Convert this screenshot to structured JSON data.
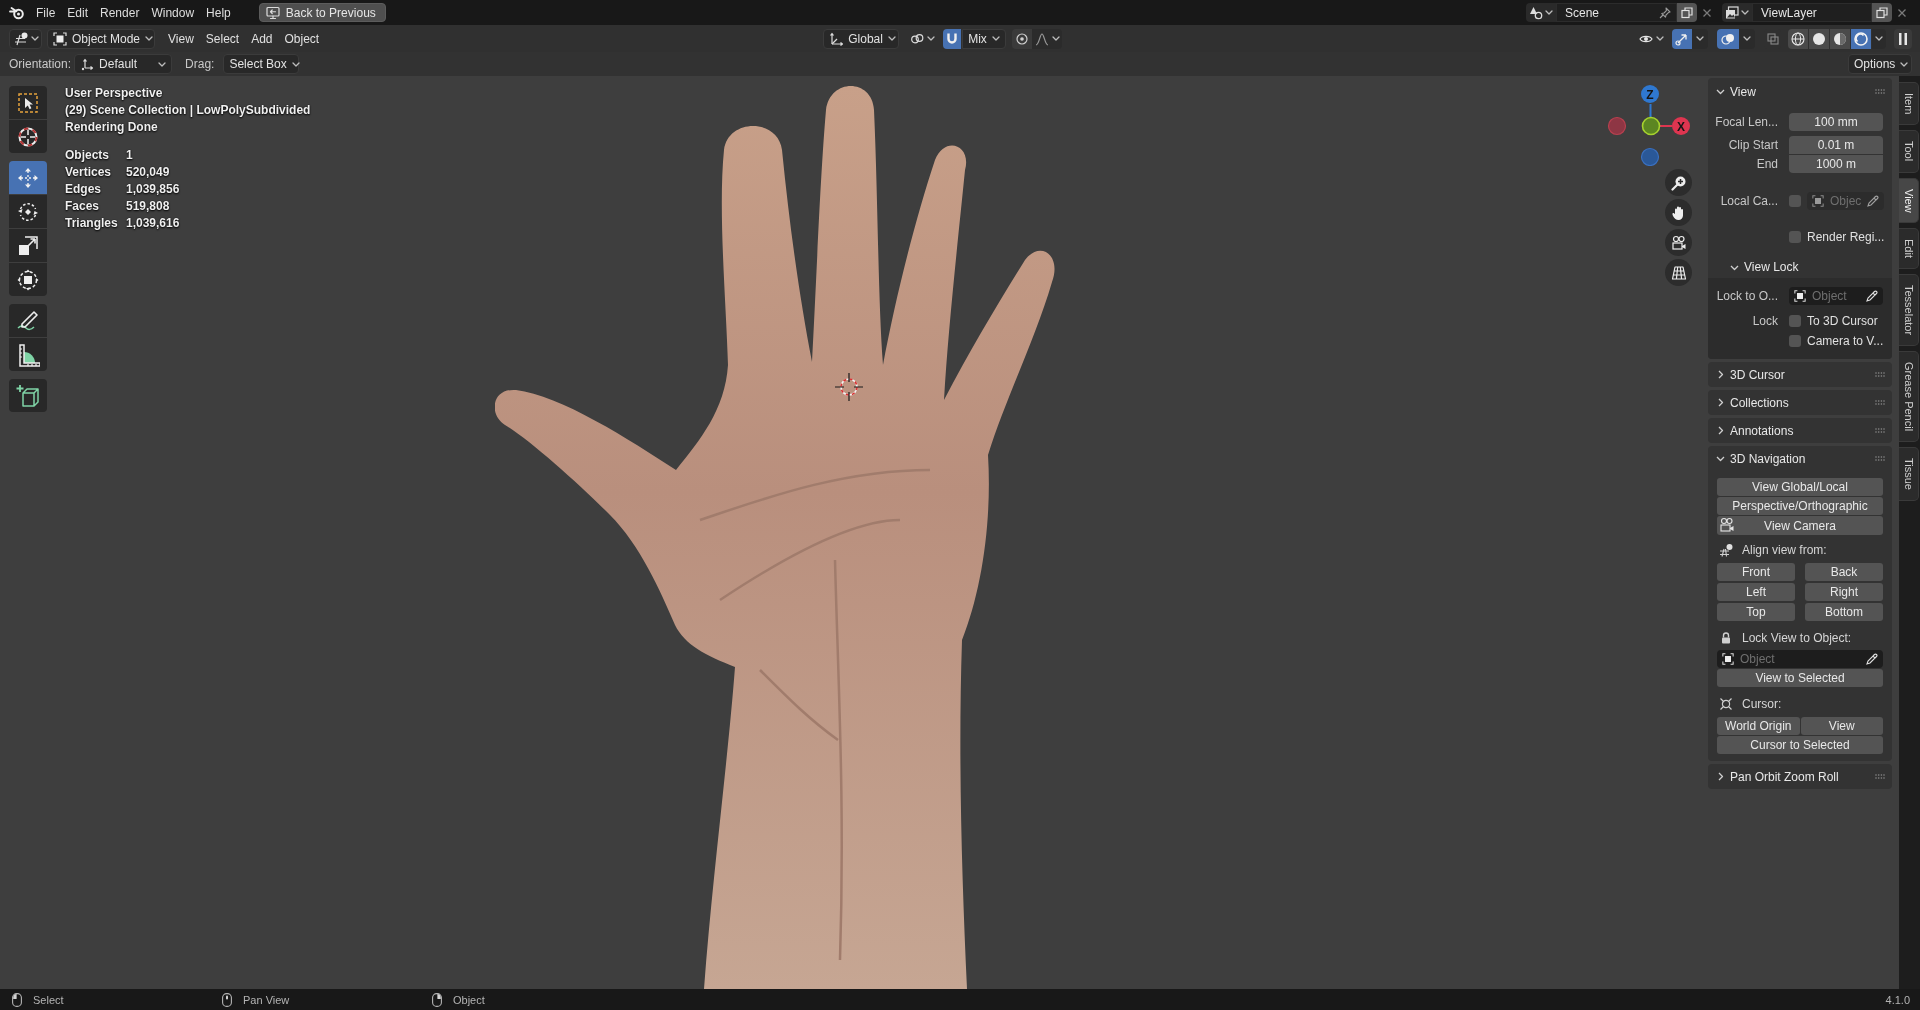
{
  "top_bar": {
    "menus": [
      "File",
      "Edit",
      "Render",
      "Window",
      "Help"
    ],
    "back_button": "Back to Previous",
    "scene": "Scene",
    "view_layer": "ViewLayer"
  },
  "header": {
    "mode": "Object Mode",
    "menus": [
      "View",
      "Select",
      "Add",
      "Object"
    ],
    "orientation": "Global",
    "snap": {
      "on": true,
      "target": "Mix"
    },
    "proportional_editing": {
      "on": false
    },
    "show_gizmo": {
      "on": true
    },
    "show_overlays": {
      "on": true
    },
    "xray": {
      "on": false
    },
    "shading": [
      {
        "kind": "wireframe",
        "selected": false
      },
      {
        "kind": "solid",
        "selected": false
      },
      {
        "kind": "material",
        "selected": false
      },
      {
        "kind": "rendered",
        "selected": true
      }
    ]
  },
  "tool_settings": {
    "orientation_label": "Orientation:",
    "orientation": "Default",
    "drag_label": "Drag:",
    "drag": "Select Box",
    "options": "Options"
  },
  "toolbar": {
    "groups": [
      {
        "tools": [
          {
            "kind": "select_box",
            "selected": false
          },
          {
            "kind": "cursor",
            "selected": false
          }
        ]
      },
      {
        "tools": [
          {
            "kind": "move",
            "selected": true
          },
          {
            "kind": "rotate",
            "selected": false
          },
          {
            "kind": "scale",
            "selected": false
          },
          {
            "kind": "transform",
            "selected": false
          }
        ]
      },
      {
        "tools": [
          {
            "kind": "annotate",
            "selected": false
          },
          {
            "kind": "measure",
            "selected": false
          }
        ]
      },
      {
        "tools": [
          {
            "kind": "add_cube",
            "selected": false
          }
        ]
      }
    ]
  },
  "viewport_info": {
    "lines": [
      "User Perspective",
      "(29) Scene Collection | LowPolySubdivided",
      "Rendering Done"
    ],
    "stats": [
      {
        "label": "Objects",
        "value": "1"
      },
      {
        "label": "Vertices",
        "value": "520,049"
      },
      {
        "label": "Edges",
        "value": "1,039,856"
      },
      {
        "label": "Faces",
        "value": "519,808"
      },
      {
        "label": "Triangles",
        "value": "1,039,616"
      }
    ]
  },
  "gizmo": {
    "z_label": "Z",
    "x_label": "X"
  },
  "sidebar": {
    "panels": [
      {
        "kind": "view",
        "title": "View",
        "expanded": true,
        "fields": [
          {
            "label": "Focal Len...",
            "value": "100 mm"
          },
          {
            "label": "Clip Start",
            "value": "0.01 m"
          },
          {
            "label": "End",
            "value": "1000 m"
          }
        ],
        "local_camera": {
          "label": "Local Ca...",
          "checked": false,
          "placeholder": "Objec"
        },
        "render_region": {
          "label": "Render Regi...",
          "checked": false
        },
        "view_lock": {
          "title": "View Lock",
          "expanded": true,
          "lock_object": {
            "label": "Lock to O...",
            "placeholder": "Object"
          },
          "lock_label": "Lock",
          "options": [
            {
              "label": "To 3D Cursor",
              "checked": false
            },
            {
              "label": "Camera to V...",
              "checked": false
            }
          ]
        }
      },
      {
        "kind": "plain",
        "title": "3D Cursor",
        "expanded": false
      },
      {
        "kind": "plain",
        "title": "Collections",
        "expanded": false
      },
      {
        "kind": "plain",
        "title": "Annotations",
        "expanded": false
      },
      {
        "kind": "navigation",
        "title": "3D Navigation",
        "expanded": true,
        "buttons": [
          "View Global/Local",
          "Perspective/Orthographic"
        ],
        "camera_button": "View Camera",
        "align_label": "Align view from:",
        "align_buttons": [
          "Front",
          "Back",
          "Left",
          "Right",
          "Top",
          "Bottom"
        ],
        "lock_label": "Lock View to Object:",
        "lock_object": {
          "placeholder": "Object"
        },
        "view_selected": "View to Selected",
        "cursor_label": "Cursor:",
        "cursor_buttons": [
          "World Origin",
          "View"
        ],
        "cursor_selected": "Cursor to Selected"
      },
      {
        "kind": "plain",
        "title": "Pan Orbit Zoom Roll",
        "expanded": false
      }
    ],
    "tabs": [
      {
        "label": "Item",
        "selected": false
      },
      {
        "label": "Tool",
        "selected": false
      },
      {
        "label": "View",
        "selected": true
      },
      {
        "label": "Edit",
        "selected": false
      },
      {
        "label": "Tesselator",
        "selected": false
      },
      {
        "label": "Grease Pencil",
        "selected": false
      },
      {
        "label": "Tissue",
        "selected": false
      }
    ]
  },
  "status_bar": {
    "hints": [
      {
        "kind": "left_click",
        "label": "Select"
      },
      {
        "kind": "middle_click",
        "label": "Pan View"
      },
      {
        "kind": "right_click",
        "label": "Object"
      }
    ],
    "version": "4.1.0"
  }
}
